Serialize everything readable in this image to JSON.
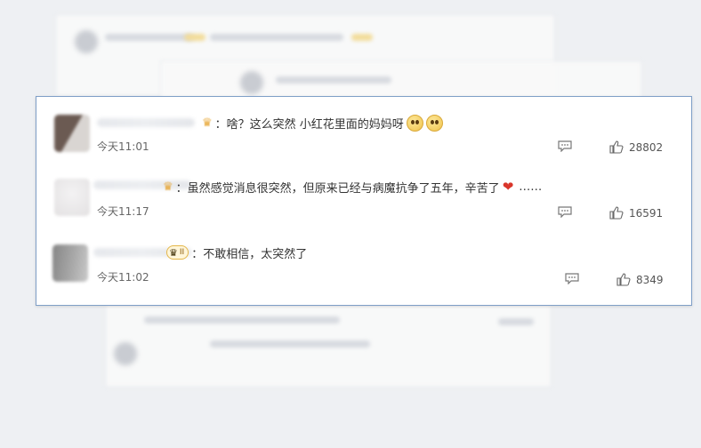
{
  "comments": [
    {
      "message": "啥？这么突然 小红花里面的妈妈呀",
      "emoji_names": [
        "pleading-face",
        "pleading-face"
      ],
      "time": "今天11:01",
      "likes": "28802",
      "avatar_colors": [
        "#6b5a52",
        "#d9d5d2"
      ]
    },
    {
      "message": "虽然感觉消息很突然，但原来已经与病魔抗争了五年，辛苦了",
      "emoji_names": [
        "red-heart"
      ],
      "trailing": "……",
      "time": "今天11:17",
      "likes": "16591",
      "avatar_colors": [
        "#e7e5e6",
        "#f0eff0"
      ]
    },
    {
      "message": "不敢相信，太突然了",
      "badge": "II",
      "time": "今天11:02",
      "likes": "8349",
      "avatar_colors": [
        "#858585",
        "#bdbdbd"
      ]
    }
  ],
  "colors": {
    "card_border": "#7f9fc7",
    "crown": "#e7a634",
    "heart": "#d9362b"
  },
  "icons": [
    "crown-icon",
    "vip-badge-icon",
    "reply-icon",
    "thumbs-up-icon"
  ]
}
